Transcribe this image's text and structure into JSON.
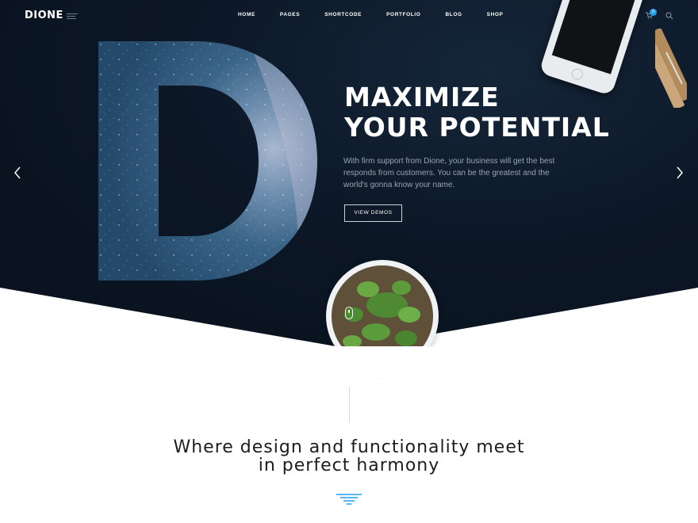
{
  "header": {
    "logo": "DIONE",
    "nav": [
      "HOME",
      "PAGES",
      "SHORTCODE",
      "PORTFOLIO",
      "BLOG",
      "SHOP"
    ],
    "cart_count": "0"
  },
  "hero": {
    "title_line1": "MAXIMIZE",
    "title_line2": "YOUR POTENTIAL",
    "description": "With firm support from Dione, your business will get the best responds from customers. You can be the greatest and the world's gonna know your name.",
    "button_label": "VIEW DEMOS"
  },
  "section": {
    "tagline_line1": "Where design and functionality meet",
    "tagline_line2": "in perfect harmony"
  },
  "colors": {
    "hero_bg": "#0c1726",
    "accent": "#1da1f2",
    "text_dark": "#1b1d21"
  },
  "icons": [
    "cart-icon",
    "search-icon",
    "arrow-left-icon",
    "arrow-right-icon",
    "mouse-scroll-icon",
    "filter-lines-icon"
  ]
}
